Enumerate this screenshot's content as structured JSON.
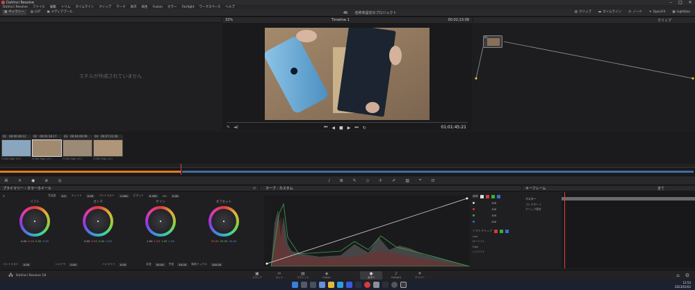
{
  "window": {
    "title": "DaVinci Resolve"
  },
  "menu": [
    "DaVinci Resolve",
    "ファイル",
    "編集",
    "トリム",
    "タイムライン",
    "クリップ",
    "マーク",
    "表示",
    "再生",
    "Fusion",
    "カラー",
    "Fairlight",
    "ワークスペース",
    "ヘルプ"
  ],
  "toolbar": {
    "gallery_btn": "ギャラリー",
    "lut_btn": "LUT",
    "media_btn": "メディアプール",
    "resolution": "4K",
    "project_title": "名称未設定のプロジェクト",
    "clips_btn": "クリップ",
    "timeline_btn": "タイムライン",
    "nodes_btn": "ノード",
    "effects_btn": "OpenFX",
    "lightbox_btn": "Lightbox"
  },
  "gallery": {
    "empty_message": "スチルが作成されていません"
  },
  "viewer": {
    "zoom": "33%",
    "timeline_name": "Timeline 1",
    "header_tc": "00:02:23:08",
    "timecode": "01:01:45:21"
  },
  "nodes": {
    "mode": "クリップ",
    "node_label": "01"
  },
  "clips": [
    {
      "num": "01",
      "tc": "00:00:06:12",
      "name": "H.264 High L5.1"
    },
    {
      "num": "02",
      "tc": "00:01:16:17",
      "name": "H.264 High L5.1"
    },
    {
      "num": "03",
      "tc": "00:04:00:09",
      "name": "H.264 High L5.1"
    },
    {
      "num": "04",
      "tc": "00:07:21:00",
      "name": "H.264 High L5.1"
    }
  ],
  "primaries": {
    "title": "プライマリー・カラーホイール",
    "temp_label": "色温度",
    "temp_value": "0.0",
    "tint_label": "ティント",
    "tint_value": "0.00",
    "contrast_label": "コントラスト",
    "contrast_value": "1.000",
    "pivot_label": "ピボット",
    "pivot_value": "0.435",
    "md_label": "MD",
    "md_value": "0.00",
    "contrast_bottom": "0.00",
    "shadows_label": "シャドウ",
    "shadows_value": "0.00",
    "highlights_label": "ハイライト",
    "highlights_value": "0.00",
    "sat_label": "彩度",
    "sat_value": "50.00",
    "hue_label": "色相",
    "hue_value": "50.00",
    "lum_label": "輝度ミックス",
    "lum_value": "100.00",
    "wheels": [
      {
        "label": "リフト",
        "vals": [
          "0.00",
          "0.00",
          "0.00",
          "0.00"
        ]
      },
      {
        "label": "ガンマ",
        "vals": [
          "0.00",
          "0.00",
          "0.00",
          "0.00"
        ]
      },
      {
        "label": "ゲイン",
        "vals": [
          "1.00",
          "1.00",
          "1.00",
          "1.00"
        ]
      },
      {
        "label": "オフセット",
        "vals": [
          "25.00",
          "25.00",
          "25.00",
          ""
        ]
      }
    ]
  },
  "curves": {
    "title": "カーブ - カスタム",
    "edit_label": "編集",
    "soft_clip_label": "ソフトクリップ",
    "edit_values": [
      "100",
      "100",
      "100",
      "100"
    ],
    "soft_rows": [
      "Low",
      "ローソフト",
      "High",
      "ハイソフト"
    ]
  },
  "keyframes": {
    "title": "キーフレーム",
    "all_label": "全て",
    "master_label": "マスター",
    "correction_label": "コレクター 1",
    "sizing_label": "クリップ属性"
  },
  "pages": [
    {
      "label": "メディア",
      "icon": "▣"
    },
    {
      "label": "カット",
      "icon": "✂"
    },
    {
      "label": "エディット",
      "icon": "▤"
    },
    {
      "label": "Fusion",
      "icon": "◈"
    },
    {
      "label": "カラー",
      "icon": "◉"
    },
    {
      "label": "Fairlight",
      "icon": "♪"
    },
    {
      "label": "デリバー",
      "icon": "✈"
    }
  ],
  "status": {
    "app_name": "DaVinci Resolve 18"
  },
  "taskbar": {
    "time": "12:54",
    "date": "2023/01/02"
  },
  "colors": {
    "accent": "#e63c3c",
    "orange": "#e07b22",
    "selected_page": "#3a3a3e"
  }
}
